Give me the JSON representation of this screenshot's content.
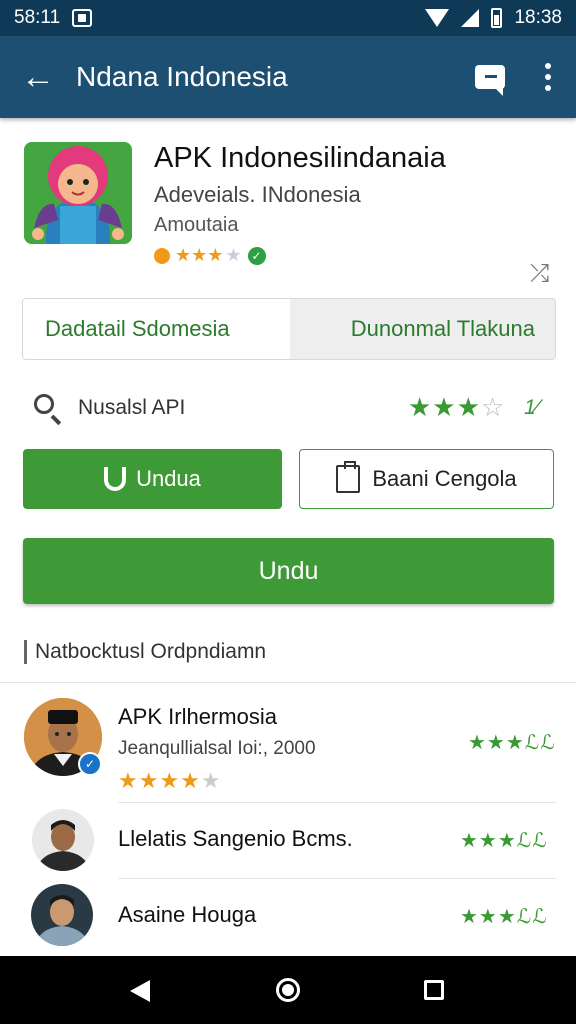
{
  "status_bar": {
    "time_left": "58:11",
    "time_right": "18:38"
  },
  "app_bar": {
    "title": "Ndana Indonesia"
  },
  "app": {
    "name": "APK Indonesilindanaia",
    "developer": "Adeveials. INdonesia",
    "category": "Amoutaia",
    "rating_stars": "★★★"
  },
  "tabs": {
    "left": "Dadatail Sdomesia",
    "right": "Dunonmal Tlakuna"
  },
  "search": {
    "label": "Nusalsl API",
    "stars": "★★★",
    "version": "1⁄"
  },
  "buttons": {
    "install": "Undua",
    "open": "Baani Cengola",
    "download": "Undu"
  },
  "section": {
    "title": "Natbocktusl Ordpndiamn"
  },
  "reviews": [
    {
      "name": "APK Irlhermosia",
      "subtitle": "Jeanqullialsal Ioi:, 2000",
      "stars": "★★★★",
      "rating": "★★★ℒℒ"
    },
    {
      "name": "Llelatis Sangenio Bcms.",
      "rating": "★★★ℒℒ"
    },
    {
      "name": "Asaine Houga",
      "rating": "★★★ℒℒ"
    }
  ],
  "colors": {
    "app_bar": "#1c4f72",
    "status_bar": "#0f3a57",
    "accent_green": "#3e9a37",
    "star_orange": "#f09a1a"
  }
}
